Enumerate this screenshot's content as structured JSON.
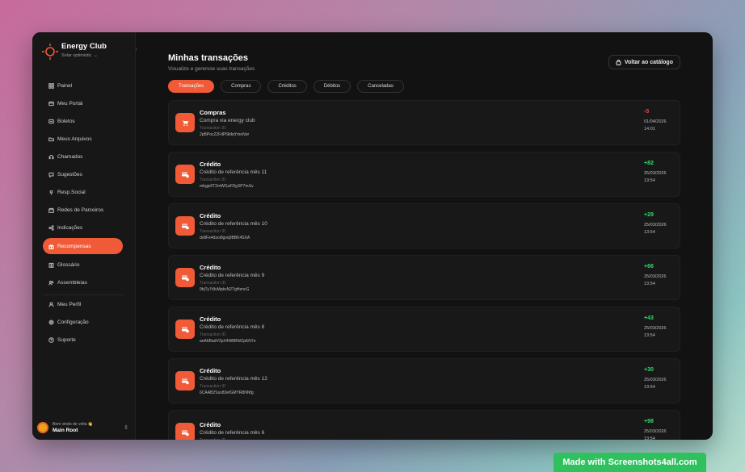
{
  "brand": {
    "title": "Energy Club",
    "subtitle": "Solar optimistic"
  },
  "nav": [
    {
      "label": "Painel",
      "icon": "grid-icon"
    },
    {
      "label": "Meu Portal",
      "icon": "portal-icon"
    },
    {
      "label": "Boletos",
      "icon": "bill-icon"
    },
    {
      "label": "Meus Arquivos",
      "icon": "folder-icon"
    },
    {
      "label": "Chamados",
      "icon": "headset-icon"
    },
    {
      "label": "Sugestões",
      "icon": "chat-icon"
    },
    {
      "label": "Resp.Social",
      "icon": "pin-icon"
    },
    {
      "label": "Redes de Parceiros",
      "icon": "store-icon"
    },
    {
      "label": "Indicações",
      "icon": "share-icon"
    },
    {
      "label": "Recompensas",
      "icon": "gift-icon",
      "active": true
    },
    {
      "label": "Glossário",
      "icon": "book-icon"
    },
    {
      "label": "Assembleias",
      "icon": "users-icon"
    }
  ],
  "nav_secondary": [
    {
      "label": "Meu Perfil",
      "icon": "user-icon"
    },
    {
      "label": "Configuração",
      "icon": "gear-icon"
    },
    {
      "label": "Suporte",
      "icon": "help-icon"
    }
  ],
  "user": {
    "welcome": "Bem vindo de volta 👋",
    "name": "Main Root"
  },
  "page": {
    "title": "Minhas transações",
    "subtitle": "Visualize e gerencie suas transações",
    "back_label": "Voltar ao catálogo"
  },
  "tabs": [
    "Transações",
    "Compras",
    "Créditos",
    "Débitos",
    "Canceladas"
  ],
  "transactions": [
    {
      "title": "Compras",
      "desc": "Compra via energy club",
      "id_label": "Transaction ID",
      "id": "2pBPoc22FdPl9ldqYmoNor",
      "amount": "-5",
      "sign": "neg",
      "date": "01/04/2026",
      "time": "14:01",
      "icon": "cart-icon"
    },
    {
      "title": "Crédito",
      "desc": "Crédito de referência mês 11",
      "id_label": "Transaction ID",
      "id": "mbgjs6T2mWGuFDgXP7mUv",
      "amount": "+82",
      "sign": "pos",
      "date": "25/03/2026",
      "time": "13:54",
      "icon": "credit-icon"
    },
    {
      "title": "Crédito",
      "desc": "Crédito de referência mês 10",
      "id_label": "Transaction ID",
      "id": "dv8Fe4dsoi9gvq9BBK4SXA",
      "amount": "+29",
      "sign": "pos",
      "date": "25/03/2026",
      "time": "13:54",
      "icon": "credit-icon"
    },
    {
      "title": "Crédito",
      "desc": "Crédito de referência mês 9",
      "id_label": "Transaction ID",
      "id": "9hjTy7r9vMpkxN2TgHencG",
      "amount": "+66",
      "sign": "pos",
      "date": "25/03/2026",
      "time": "13:54",
      "icon": "credit-icon"
    },
    {
      "title": "Crédito",
      "desc": "Crédito de referência mês 8",
      "id_label": "Transaction ID",
      "id": "anA6BadV2pX4W8BWZpEN7e",
      "amount": "+43",
      "sign": "pos",
      "date": "25/03/2026",
      "time": "13:54",
      "icon": "credit-icon"
    },
    {
      "title": "Crédito",
      "desc": "Crédito de referência mês 12",
      "id_label": "Transaction ID",
      "id": "6CAAB2Sso83efGMYR8NNfg",
      "amount": "+30",
      "sign": "pos",
      "date": "25/03/2026",
      "time": "13:54",
      "icon": "credit-icon"
    },
    {
      "title": "Crédito",
      "desc": "Crédito de referência mês 6",
      "id_label": "Transaction ID",
      "id": "",
      "amount": "+98",
      "sign": "pos",
      "date": "25/03/2026",
      "time": "13:54",
      "icon": "credit-icon"
    }
  ],
  "watermark": "Made with Screenshots4all.com",
  "colors": {
    "accent": "#f05a36",
    "positive": "#33d66a",
    "negative": "#f04444",
    "bg": "#121212"
  }
}
